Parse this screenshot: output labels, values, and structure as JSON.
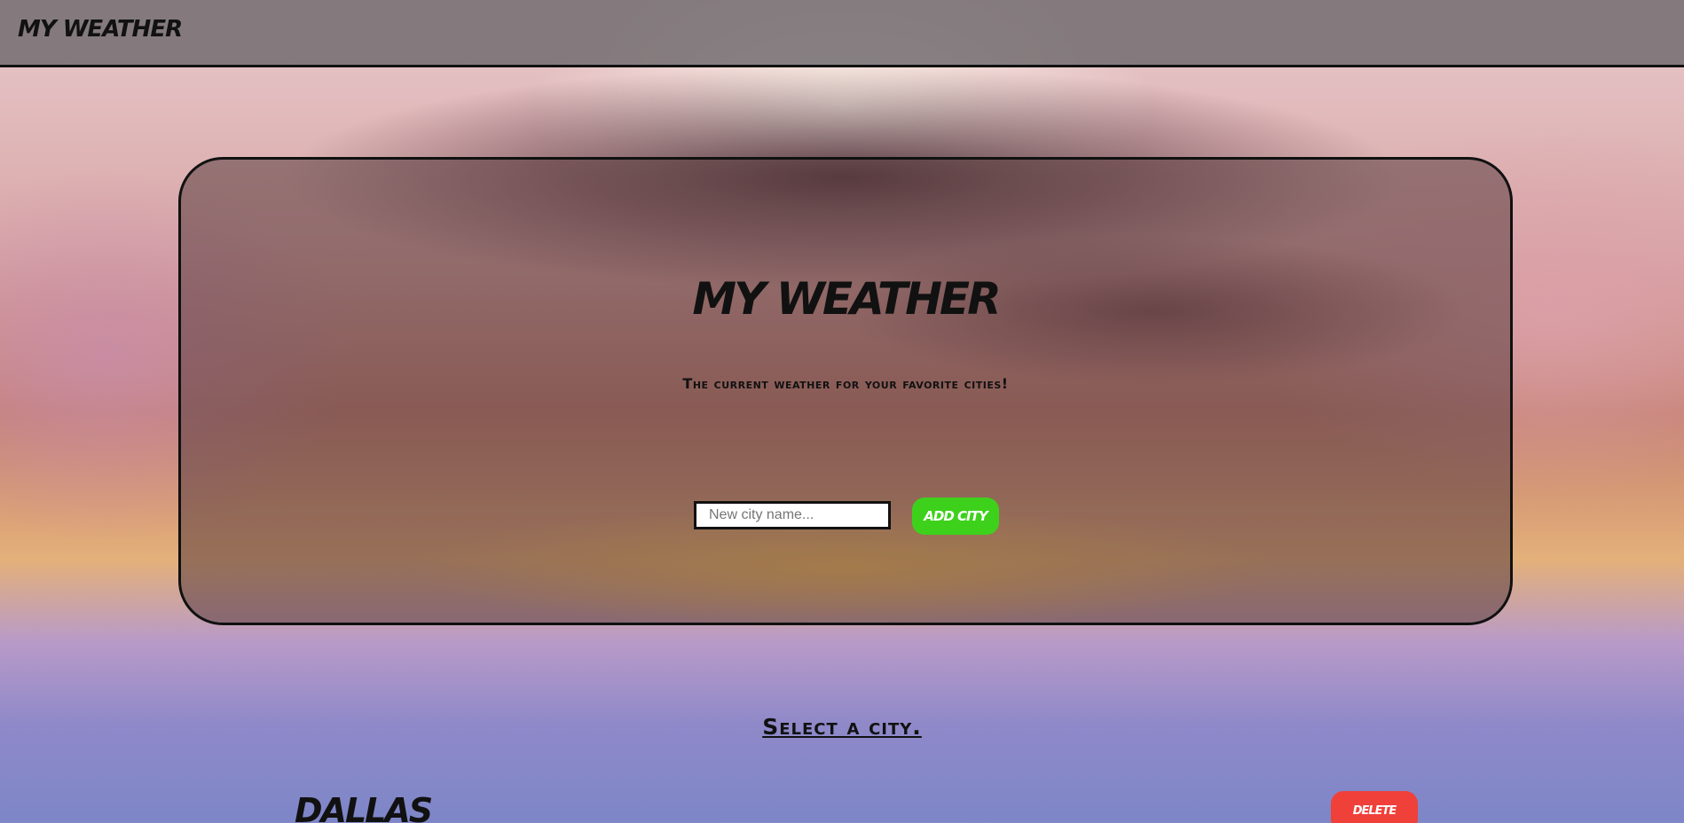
{
  "navbar": {
    "brand": "My Weather"
  },
  "hero": {
    "title": "My Weather",
    "subtitle": "The current weather for your favorite cities!",
    "city_input": {
      "value": "",
      "placeholder": "New city name..."
    },
    "add_city_label": "Add City"
  },
  "cities": {
    "heading": "Select a city.",
    "items": [
      {
        "name": "Dallas",
        "delete_label": "Delete"
      }
    ]
  },
  "colors": {
    "add_button": "#3ed11c",
    "delete_button": "#f0403a",
    "border": "#111111"
  }
}
